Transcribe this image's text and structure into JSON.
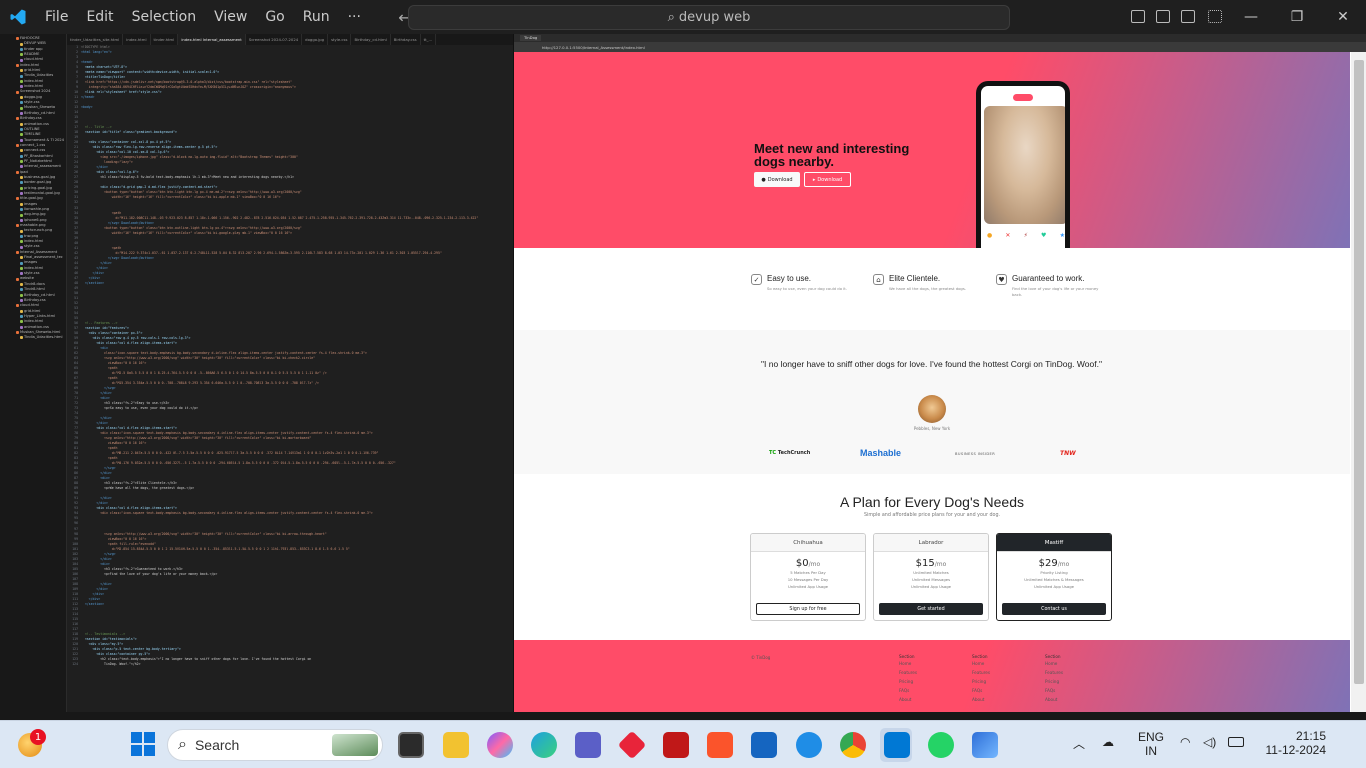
{
  "titlebar": {
    "menus": [
      "File",
      "Edit",
      "Selection",
      "View",
      "Go",
      "Run",
      "···"
    ],
    "search": "devup web"
  },
  "explorer": {
    "items": [
      "FAHOOCRE",
      "DEVUP WEB",
      "tinder app",
      "README",
      "cloud.html",
      "index.html",
      "grid.html",
      "Tindia_Udacities",
      "index.html",
      "index.html",
      "Screenshot 2024",
      "doggo.jpg",
      "style.css",
      "Muskan_Sheweta",
      "Birthday_cd.html",
      "Birthday.css",
      "animation.css",
      "OUTLINE",
      "TIMELINE",
      "Tournament & TI 2024",
      "connect_1.css",
      "connect.css",
      "PF_Bhaskarhtml",
      "PF_Notizbehtml",
      "Internal_assessment",
      "ipad",
      "business-goal.jpg",
      "border-goal.jpg",
      "pricing-goal.jpg",
      "testimonial-goal.jpg",
      "title-goal.jpg",
      "images",
      "lionwahle.png",
      "dog-img.jpg",
      "iphone6.png",
      "mashable.png",
      "techcrunch.png",
      "tnw.png",
      "index.html",
      "style.css",
      "Internal_Assessment",
      "Final_assessment_tec",
      "images",
      "index.html",
      "style.css",
      "website",
      "Tindr8.docs",
      "Tindr8.html",
      "Birthday_cd.html",
      "Birthday.css",
      "cloud.html",
      "grid.html",
      "Hyper_Links.html",
      "index.html",
      "animation.css",
      "Muskan_Sheweta.html",
      "Tindia_Udacities.html"
    ]
  },
  "editor": {
    "tabs": [
      "tinder_Udacities_site.html",
      "index.html",
      "tinder.html",
      "index.html Internal_assessment",
      "Screenshot 2024-07-2024",
      "doggo.jpg",
      "style.css",
      "Birthday_cd.html",
      "Birthday.css",
      "tt_..."
    ],
    "lines": [
      [
        "p",
        "<!DOCTYPE html>"
      ],
      [
        "t",
        "<html lang=\"en\">"
      ],
      [
        "x",
        ""
      ],
      [
        "t",
        "<head>"
      ],
      [
        "a",
        "  <meta charset=\"UTF-8\">"
      ],
      [
        "a",
        "  <meta name=\"viewport\" content=\"width=device-width, initial-scale=1.0\">"
      ],
      [
        "a",
        "  <title>TinDog</title>"
      ],
      [
        "s",
        "  <link href=\"https://cdn.jsdelivr.net/npm/bootstrap@5.3.0-alpha3/dist/css/bootstrap.min.css\" rel=\"stylesheet\""
      ],
      [
        "s",
        "    integrity=\"sha384-KK94CHFLLe+nY2dmCWGMq91rCGa5gtU4mk92HdvYe+M/SXH301p5ILy+dN9+nJOZ\" crossorigin=\"anonymous\">"
      ],
      [
        "a",
        "  <link rel=\"stylesheet\" href=\"style.css\">"
      ],
      [
        "t",
        "</head>"
      ],
      [
        "x",
        ""
      ],
      [
        "t",
        "<body>"
      ],
      [
        "x",
        ""
      ],
      [
        "x",
        ""
      ],
      [
        "x",
        ""
      ],
      [
        "c",
        "  <!-- Title -->"
      ],
      [
        "a",
        "  <section id=\"title\" class=\"gradient-background\">"
      ],
      [
        "x",
        ""
      ],
      [
        "a",
        "    <div class=\"container col-xxl-8 px-4 pt-5\">"
      ],
      [
        "a",
        "      <div class=\"row flex-lg-row-reverse align-items-center g-5 pt-5\">"
      ],
      [
        "a",
        "        <div class=\"col-10 col-sm-8 col-lg-6\">"
      ],
      [
        "s",
        "          <img src=\"./images/iphone.jpg\" class=\"d-block mx-lg-auto img-fluid\" alt=\"Bootstrap Themes\" height=\"300\""
      ],
      [
        "s",
        "            loading=\"lazy\">"
      ],
      [
        "t",
        "        </div>"
      ],
      [
        "a",
        "        <div class=\"col-lg-6\">"
      ],
      [
        "x",
        "          <h1 class=\"display-5 fw-bold text-body-emphasis lh-1 mb-3\">Meet new and interesting dogs nearby.</h1>"
      ],
      [
        "x",
        ""
      ],
      [
        "a",
        "          <div class=\"d-grid gap-2 d-md-flex justify-content-md-start\">"
      ],
      [
        "s",
        "            <button type=\"button\" class=\"btn btn-light btn-lg px-4 me-md-2\"><svg xmlns=\"http://www.w3.org/2000/svg\""
      ],
      [
        "s",
        "                width=\"16\" height=\"16\" fill=\"currentColor\" class=\"bi bi-apple mb-1\" viewBox=\"0 0 16 16\">"
      ],
      [
        "x",
        ""
      ],
      [
        "x",
        ""
      ],
      [
        "s",
        "                <path"
      ],
      [
        "s",
        "                  d=\"M11.182.008C11.148-.03 9.923.023 8.857 1.18c-1.066 1.156-.902 2.482-.878 2.516.024.034 1.52.087 2.475-1.258.955-1.345.762-2.391.728-2.43Zm3.314 11.733c-.048-.096-2.325-1.234-2.113-3.422\""
      ],
      [
        "t",
        "              </svg> Download</button>"
      ],
      [
        "s",
        "            <button type=\"button\" class=\"btn btn-outline-light btn-lg px-4\"><svg xmlns=\"http://www.w3.org/2000/svg\""
      ],
      [
        "s",
        "                width=\"16\" height=\"16\" fill=\"currentColor\" class=\"bi bi-google-play mb-1\" viewBox=\"0 0 16 16\">"
      ],
      [
        "x",
        ""
      ],
      [
        "x",
        ""
      ],
      [
        "s",
        "                <path"
      ],
      [
        "s",
        "                  d=\"M14.222 9.374c1.037-.61 1.037-2.137 0-2.748L11.528 5.04 8.32 8l3.207 2.96 2.694-1.586Zm-3.595 2.116L7.583 8.68 1.03 14.73c.201 1.029 1.36 1.61 2.303 1.055l7.294-4.295\""
      ],
      [
        "t",
        "              </svg> Download</button>"
      ],
      [
        "t",
        "          </div>"
      ],
      [
        "t",
        "        </div>"
      ],
      [
        "t",
        "      </div>"
      ],
      [
        "t",
        "    </div>"
      ],
      [
        "t",
        "  </section>"
      ],
      [
        "x",
        ""
      ],
      [
        "x",
        ""
      ],
      [
        "x",
        ""
      ],
      [
        "x",
        ""
      ],
      [
        "x",
        ""
      ],
      [
        "x",
        ""
      ],
      [
        "x",
        ""
      ],
      [
        "c",
        "  <!-- Features -->"
      ],
      [
        "a",
        "  <section id=\"features\">"
      ],
      [
        "a",
        "    <div class=\"container px-5\">"
      ],
      [
        "a",
        "      <div class=\"row g-4 py-5 row-cols-1 row-cols-lg-3\">"
      ],
      [
        "a",
        "        <div class=\"col d-flex align-items-start\">"
      ],
      [
        "t",
        "          <div"
      ],
      [
        "s",
        "            class=\"icon-square text-body-emphasis bg-body-secondary d-inline-flex align-items-center justify-content-center fs-4 flex-shrink-0 me-3\">"
      ],
      [
        "s",
        "            <svg xmlns=\"http://www.w3.org/2000/svg\" width=\"30\" height=\"30\" fill=\"currentColor\" class=\"bi bi-check2-circle\""
      ],
      [
        "s",
        "              viewBox=\"0 0 16 16\">"
      ],
      [
        "s",
        "              <path"
      ],
      [
        "s",
        "                d=\"M2.5 8a5.5 5.5 0 0 1 8.25-4.764.5.5 0 0 0 .5-.866A6.5 6.5 0 1 0 14.5 8a.5.5 0 0 0-1 0 5.5 5.5 0 1 1-11 0z\" />"
      ],
      [
        "s",
        "              <path"
      ],
      [
        "s",
        "                d=\"M15.354 3.354a.5.5 0 0 0-.708-.708L8 9.293 5.354 6.646a.5.5 0 1 0-.708.708l3 3a.5.5 0 0 0 .708 0l7-7z\" />"
      ],
      [
        "t",
        "            </svg>"
      ],
      [
        "t",
        "          </div>"
      ],
      [
        "t",
        "          <div>"
      ],
      [
        "x",
        "            <h3 class=\"fs-2\">Easy to use.</h3>"
      ],
      [
        "x",
        "            <p>So easy to use, even your dog could do it.</p>"
      ],
      [
        "x",
        ""
      ],
      [
        "t",
        "          </div>"
      ],
      [
        "t",
        "        </div>"
      ],
      [
        "a",
        "        <div class=\"col d-flex align-items-start\">"
      ],
      [
        "s",
        "          <div class=\"icon-square text-body-emphasis bg-body-secondary d-inline-flex align-items-center justify-content-center fs-4 flex-shrink-0 me-3\">"
      ],
      [
        "s",
        "            <svg xmlns=\"http://www.w3.org/2000/svg\" width=\"30\" height=\"30\" fill=\"currentColor\" class=\"bi bi-mortarboard\""
      ],
      [
        "s",
        "              viewBox=\"0 0 16 16\">"
      ],
      [
        "s",
        "              <path"
      ],
      [
        "s",
        "                d=\"M8.211 2.047a.5.5 0 0 0-.422 0l-7.5 3.5a.5.5 0 0 0 .025.917l7.5 3a.5.5 0 0 0 .372 0L14 7.14V13a1 1 0 0 0-1 1v2h3v-2a1 1 0 0 0-1-1V6.739\""
      ],
      [
        "s",
        "              <path"
      ],
      [
        "s",
        "                d=\"M4.176 9.032a.5.5 0 0 0-.656.327l-.5 1.7a.5.5 0 0 0 .294.605l4.5 1.8a.5.5 0 0 0 .372 0l4.5-1.8a.5.5 0 0 0 .294-.605l-.5-1.7a.5.5 0 0 0-.656-.327\""
      ],
      [
        "t",
        "            </svg>"
      ],
      [
        "t",
        "          </div>"
      ],
      [
        "t",
        "          <div>"
      ],
      [
        "x",
        "            <h3 class=\"fs-2\">Elite Clientele.</h3>"
      ],
      [
        "x",
        "            <p>We have all the dogs, the greatest dogs.</p>"
      ],
      [
        "x",
        ""
      ],
      [
        "t",
        "          </div>"
      ],
      [
        "t",
        "        </div>"
      ],
      [
        "a",
        "        <div class=\"col d-flex align-items-start\">"
      ],
      [
        "s",
        "          <div class=\"icon-square text-body-emphasis bg-body-secondary d-inline-flex align-items-center justify-content-center fs-4 flex-shrink-0 me-3\">"
      ],
      [
        "x",
        ""
      ],
      [
        "x",
        ""
      ],
      [
        "x",
        ""
      ],
      [
        "s",
        "            <svg xmlns=\"http://www.w3.org/2000/svg\" width=\"30\" height=\"30\" fill=\"currentColor\" class=\"bi bi-arrow-through-heart\""
      ],
      [
        "s",
        "              viewBox=\"0 0 16 16\">"
      ],
      [
        "s",
        "              <path fill-rule=\"evenodd\""
      ],
      [
        "s",
        "                d=\"M2.854 15.854A.5.5 0 0 1 2 15.5V14H.5a.5.5 0 0 1-.354-.853l1.5-1.5A.5.5 0 0 1 2 11h1.793l.853-.853C3.1 8.6 1.5 6.6 1.5 5\""
      ],
      [
        "t",
        "            </svg>"
      ],
      [
        "t",
        "          </div>"
      ],
      [
        "t",
        "          <div>"
      ],
      [
        "x",
        "            <h3 class=\"fs-2\">Guaranteed to work.</h3>"
      ],
      [
        "x",
        "            <p>Find the love of your dog's life or your money back.</p>"
      ],
      [
        "x",
        ""
      ],
      [
        "t",
        "          </div>"
      ],
      [
        "t",
        "        </div>"
      ],
      [
        "t",
        "      </div>"
      ],
      [
        "t",
        "    </div>"
      ],
      [
        "t",
        "  </section>"
      ],
      [
        "x",
        ""
      ],
      [
        "x",
        ""
      ],
      [
        "x",
        ""
      ],
      [
        "x",
        ""
      ],
      [
        "x",
        ""
      ],
      [
        "c",
        "  <!-- Testimonials -->"
      ],
      [
        "a",
        "  <section id=\"testimonials\">"
      ],
      [
        "a",
        "    <div class=\"my-5\">"
      ],
      [
        "a",
        "      <div class=\"p-5 text-center bg-body-tertiary\">"
      ],
      [
        "a",
        "        <div class=\"container py-5\">"
      ],
      [
        "x",
        "          <h2 class=\"text-body-emphasis\">\"I no longer have to sniff other dogs for love. I've found the hottest Corgi on"
      ],
      [
        "x",
        "            TinDog. Woof.\"</h2>"
      ]
    ]
  },
  "browser": {
    "tab_label": "TinDog",
    "url": "http://127.0.0.1:5500/Internal_Assessment/index.html",
    "hero": {
      "heading": "Meet new and interesting dogs nearby.",
      "btn_apple": "Download",
      "btn_play": "Download"
    },
    "features": [
      {
        "title": "Easy to use.",
        "desc": "So easy to use, even your dog could do it."
      },
      {
        "title": "Elite Clientele.",
        "desc": "We have all the dogs, the greatest dogs."
      },
      {
        "title": "Guaranteed to work.",
        "desc": "Find the love of your dog's life or your money back."
      }
    ],
    "testimonial": {
      "quote": "\"I no longer have to sniff other dogs for love. I've found the hottest Corgi on TinDog. Woof.\"",
      "author": "Pebbles, New York"
    },
    "press": [
      "TechCrunch",
      "Mashable",
      "BUSINESS INSIDER",
      "TNW"
    ],
    "pricing": {
      "title": "A Plan for Every Dog's Needs",
      "subtitle": "Simple and affordable price plans for your and your dog.",
      "plans": [
        {
          "name": "Chihuahua",
          "price": "$0",
          "per": "/mo",
          "lines": [
            "5 Matches Per Day",
            "10 Messages Per Day",
            "Unlimited App Usage"
          ],
          "button": "Sign up for free"
        },
        {
          "name": "Labrador",
          "price": "$15",
          "per": "/mo",
          "lines": [
            "Unlimited Matches",
            "Unlimited Messages",
            "Unlimited App Usage"
          ],
          "button": "Get started"
        },
        {
          "name": "Mastiff",
          "price": "$29",
          "per": "/mo",
          "lines": [
            "Priority Listing",
            "Unlimited Matches & Messages",
            "Unlimited App Usage"
          ],
          "button": "Contact us"
        }
      ]
    },
    "footer": {
      "copyright": "© TinDog",
      "columns": [
        {
          "title": "Section",
          "links": [
            "Home",
            "Features",
            "Pricing",
            "FAQs",
            "About"
          ]
        },
        {
          "title": "Section",
          "links": [
            "Home",
            "Features",
            "Pricing",
            "FAQs",
            "About"
          ]
        },
        {
          "title": "Section",
          "links": [
            "Home",
            "Features",
            "Pricing",
            "FAQs",
            "About"
          ]
        }
      ]
    }
  },
  "taskbar": {
    "search": "Search",
    "badge": "1",
    "lang_top": "ENG",
    "lang_bottom": "IN",
    "time": "21:15",
    "date": "11-12-2024"
  },
  "colors": {
    "gradient_start": "#ff4c68",
    "gradient_end": "#7f72b6",
    "vscode_blue": "#0078d4"
  }
}
